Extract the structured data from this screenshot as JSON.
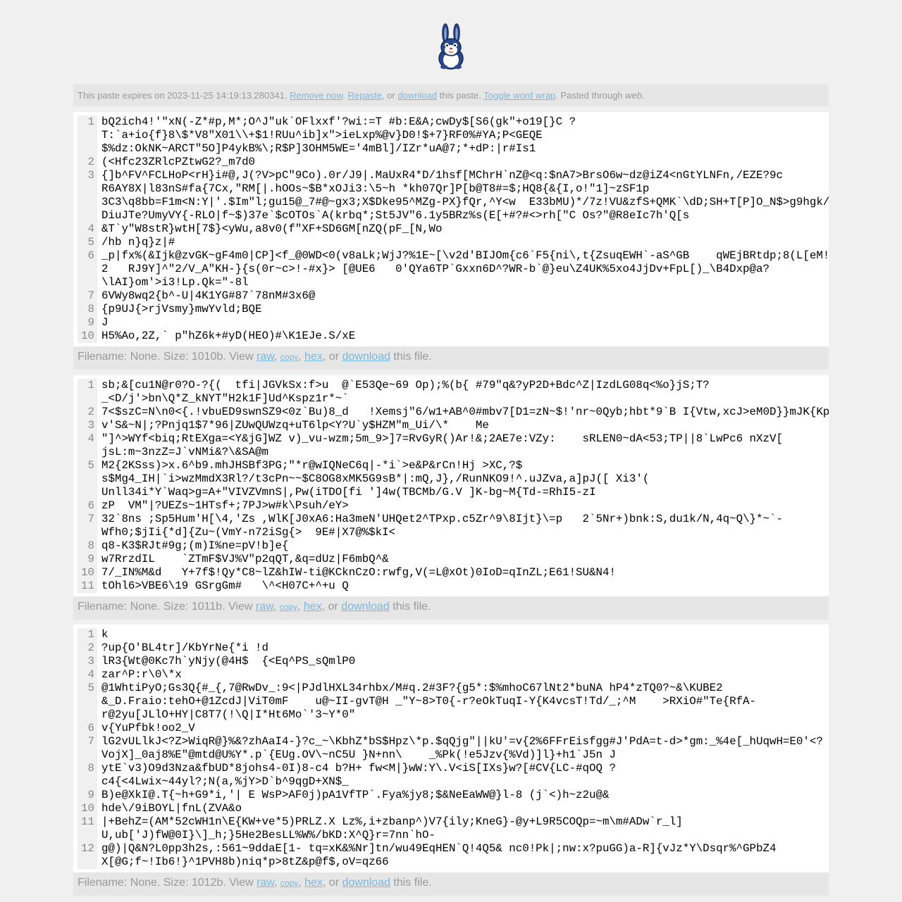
{
  "header": {
    "logo_icon": "rabbit-mascot-icon"
  },
  "notice": {
    "prefix": "This paste expires on 2023-11-25 14:19:13.280341. ",
    "remove_label": "Remove now",
    "sep1": ". ",
    "repaste_label": "Repaste",
    "sep2": ", or ",
    "download_label": "download",
    "sep3": " this paste. ",
    "wrap_label": "Toggle word wrap",
    "sep4": ". Pasted through ",
    "via": "web",
    "end": "."
  },
  "files": [
    {
      "lines": [
        {
          "n": "1",
          "t": "bQ2ich4!'\"xN(-Z*#p,M*;O^J\"uk`OFlxxf'?wi:=T #b:E&A;cwDy$[S6(gk\"+o19[}C ?\nT:`a+io{f}8\\$*V8\"X01\\\\+$1!RUu^ib]x\">ieLxp%@v}D0!$+7}RF0%#YA;P<GEQE\n$%dz:OkNK~ARCT\"5O]P4ykB%\\;R$P]3OHM5WE='4mBl]/IZr*uA@7;*+dP:|r#Is1"
        },
        {
          "n": "2",
          "t": "(<Hfc23ZRlcPZtwG2?_m7d0"
        },
        {
          "n": "3",
          "t": "{]b^FV^FCLHoP<rH}i#@,J(?V>pC\"9Co).0r/J9|.MaUxR4*D/1hsf[MChrH`nZ@<q:$nA7>BrsO6w~dz@iZ4<nGtYLNFn,/EZE?9c\nR6AY8X|l83nS#fa{7Cx,\"RM[|.hOOs~$B*xOJi3:\\5~h *kh07Qr]P[b@T8#=$;HQ8{&{I,o!\"1]~zSF1p\n3C3\\q8bb=F1m<N:Y|'.$Im\"l;gu15@_7#@~gx3;X$Dke95^MZg-PX}fQr,^Y<w  E33bMU)*/7z!VU&zfS+QMK`\\dD;SH+T[P]O_N$>g9hgk/\nDiuJTe?UmyVY{-RLO|f~$)37e`$cOTOs`A(krbq*;St5JV\"6.1y5BRz%s(E[+#?#<>rh[\"C Os?\"@R8eIc7h'Q[s"
        },
        {
          "n": "4",
          "t": "&T`y\"W8stR}wtH[7$}<yWu,a8v0(f\"XF+SD6GM[nZQ(pF_[N,Wo"
        },
        {
          "n": "5",
          "t": "/hb n}q}z|#"
        },
        {
          "n": "6",
          "t": "_p|fx%(&Ijk@zvGK~gF4m0|CP]<f_@0WD<0(v8aLk;WjJ?%1E~[\\v2d'BIJOm{c6`F5{ni\\,t{ZsuqEWH`-aS^GB    qWEjBRtdp;8(L[eM!\n2   RJ9Y]^\"2/V_A\"KH-}{s(0r~c>!-#x}> [@UE6   0'QYa6TP`Gxxn6D^?WR-b`@}eu\\Z4UK%5xo4JjDv+FpL[)_\\B4Dxp@a?\n\\lAI}om'>i3!Lp.Qk=\"-8l"
        },
        {
          "n": "7",
          "t": "6VWy8wq2{b^-U|4K1YG#87`78nM#3x6@"
        },
        {
          "n": "8",
          "t": "{p9UJ{>rjVsmy}mwYvld;BQE"
        },
        {
          "n": "9",
          "t": "J"
        },
        {
          "n": "10",
          "t": "H5%Ao,2Z,` p\"hZ6k+#yD(HEO)#\\K1EJe.S/xE"
        }
      ],
      "footer": {
        "prefix": "Filename: None. Size: 1010b. View ",
        "raw": "raw",
        "c1": ", ",
        "copy": "copy",
        "c2": ", ",
        "hex": "hex",
        "c3": ", or ",
        "download": "download",
        "suffix": " this file."
      }
    },
    {
      "lines": [
        {
          "n": "1",
          "t": "sb;&[cu1N@r0?O-?{(  tfi|JGVkSx:f>u  @`E53Qe~69 Op);%(b{ #79\"q&?yP2D+Bdc^Z|IzdLG08q<%o}jS;T?\n_<D/j'>bn\\Q*Z_kNYT\"H2k1F]Ud^Kspz1r*~`"
        },
        {
          "n": "2",
          "t": "7<$szC=N\\n0<{.!vbuED9swnSZ9<0z`Bu)8_d   !Xemsj\"6/w1+AB^0#mbv7[D1=zN~$!'nr~0Qyb;hbt*9`B I{Vtw,xcJ>eM0D}}mJK{Kp"
        },
        {
          "n": "3",
          "t": "v'S&~N|;?Pnjq1$7*96|ZUwQUWzq+uT6lp<Y?U`y$HZM\"m_Ui/\\*    Me"
        },
        {
          "n": "4",
          "t": "\"]^>WYf<biq;RtEXga=<Y&jG]WZ v)_vu-wzm;5m_9>]7=RvGyR()Ar!&;2AE7e:VZy:    sRLEN0~dA<53;TP||8`LwPc6 nXzV[\njsL:m~3nzZ=J`vNMi&?\\&SA@m"
        },
        {
          "n": "5",
          "t": "M2{2KSss)>x.6^b9.mhJHSBf3PG;\"*r@wIQNeC6q|-*i`>e&P&rCn!Hj >XC,?$\ns$Mg4_IH|`i>wzMmdX3Rl?/t3cPn~~$C8OG8xMK5G9sB*|:mQ,J},/RunNKO9!^.uJZva,a]pJ([ Xi3'(\nUnll34i*Y`Waq>g=A+\"VIVZVmnS|,Pw(iTDO[fi ']4w(TBCMb/G.V ]K-bg~M{Td-=RhI5-zI"
        },
        {
          "n": "6",
          "t": "zP  VM\"|?UEZs~1HTsf+;7PJ>w#k\\Psuh/eY>"
        },
        {
          "n": "7",
          "t": "32`8ns ;Sp5Hum'H[\\4,'Zs ,WlK[J0xA6:Ha3meN'UHQet2^TPxp.c5Zr^9\\8Ijt}\\=p   2`5Nr+)bnk:S,du1k/N,4q~Q\\}*~`-\nWfh0;$jIi{*d]{Zu~(VmY-n72iSg{>  9E#|X7@%$kI<"
        },
        {
          "n": "8",
          "t": "q8-K3$RJt#9g;(m)I%ne=pV!b]e{"
        },
        {
          "n": "9",
          "t": "w7RrzdIL    `ZTmF$VJ%V\"p2qQT,&q=dUz|F6mbQ^&"
        },
        {
          "n": "10",
          "t": "7/_IN%M&d   Y+7f$!Qy*C8~lZ&hIW-ti@KCknCzO:rwfg,V(=L@xOt)0IoD=qInZL;E61!SU&N4!"
        },
        {
          "n": "11",
          "t": "tOhl6>VBE6\\19 GSrgGm#   \\^<H07C+^+u Q"
        }
      ],
      "footer": {
        "prefix": "Filename: None. Size: 1011b. View ",
        "raw": "raw",
        "c1": ", ",
        "copy": "copy",
        "c2": ", ",
        "hex": "hex",
        "c3": ", or ",
        "download": "download",
        "suffix": " this file."
      }
    },
    {
      "lines": [
        {
          "n": "1",
          "t": "k"
        },
        {
          "n": "2",
          "t": "?up{O'BL4tr]/KbYrNe{*i !d"
        },
        {
          "n": "3",
          "t": "lR3{Wt@0Kc7h`yNjy(@4H$  {<Eq^PS_sQmlP0"
        },
        {
          "n": "4",
          "t": "zar^P:r\\0\\*x"
        },
        {
          "n": "5",
          "t": "@1WhtiPyO;Gs3Q{#_{,7@RwDv_:9<|PJdlHXL34rhbx/M#q.2#3F?{g5*:$%mhoC67lNt2*buNA hP4*zTQ0?~&\\KUBE2\n&_D.Fraio:tehO+@1ZcdJ|ViT0mF    u@~II-gvT@H _\"Y~8>T0{-r?eOkTuqI-Y{K4vcsT!Td/_;^M    >RXiO#\"Te{RfA-\nr@2yu[JLlO+HY|C8T7(!\\Q|I*Ht6Mo`'3~Y*0\""
        },
        {
          "n": "6",
          "t": "v{YuPfbk!oo2_V"
        },
        {
          "n": "7",
          "t": "lG2vULlkJ<?Z>WiqR@}%&?zhAaI4-}?c_~\\KbhZ*bS$Hpz\\*p.$qQjg\"||kU'=v{2%6FFrEisfgg#J'PdA=t-d>*gm:_%4e[_hUqwH=E0'<?\nVojX]_0aj8%E\"@mtd@U%Y*.p`{EUg.OV\\~nC5U }N+nn\\    _%Pk(!e5Jzv{%Vd)]l}+h1`J5n J"
        },
        {
          "n": "8",
          "t": "ytE`v3)O9d3Nza&fbUD*8johs4-0I)8-c4 b?H+ fw<M|}wW:Y\\.V<iS[IXs}w?[#CV{LC-#qOQ ?\nc4{<4Lwix~44yl?;N(a,%jY>D`b^9qgD+XN$_"
        },
        {
          "n": "9",
          "t": "B)e@XkI@.T{~h+G9*i,'| E WsP>AF0j)pA1VfTP`.Fya%jy8;$&NeEaWW@}l-8 (j`<)h~z2u@&"
        },
        {
          "n": "10",
          "t": "hde\\/9iBOYL|fnL(ZVA&o"
        },
        {
          "n": "11",
          "t": "|+BehZ=(AM*52cWH1n\\E{KW+ve*5)PRLZ.X Lz%,i+zbanp^)V7{ily;KneG}-@y+L9R5COQp=~m\\m#ADw`r_l]\nU,ub['J)fW@0I}\\]_h;}5He2BesLL%W%/bKD:X^Q}r=7nn`hO-"
        },
        {
          "n": "12",
          "t": "g@)|Q&N?L0pp3h2s,:561~9ddaE[1- tq=xK&%Nr]tn/wu49EqHEN`Q!4Q5& nc0!Pk|;nw:x?puGG)a-R]{vJz*Y\\Dsqr%^GPbZ4\nX[@G;f~!Ib6!}^1PVH8b)niq*p>8tZ&p@f$,oV=qz66"
        }
      ],
      "footer": {
        "prefix": "Filename: None. Size: 1012b. View ",
        "raw": "raw",
        "c1": ", ",
        "copy": "copy",
        "c2": ", ",
        "hex": "hex",
        "c3": ", or ",
        "download": "download",
        "suffix": " this file."
      }
    }
  ]
}
